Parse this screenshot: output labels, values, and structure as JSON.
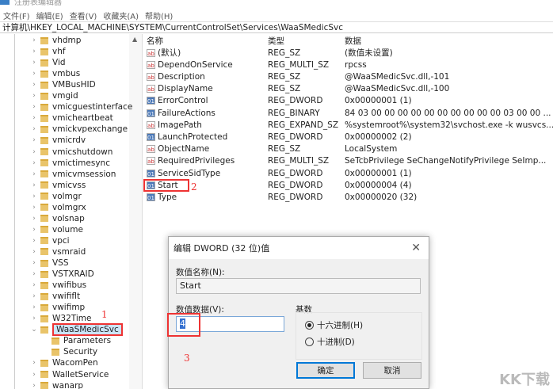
{
  "window": {
    "title": "注册表编辑器"
  },
  "menu": [
    "文件(F)",
    "编辑(E)",
    "查看(V)",
    "收藏夹(A)",
    "帮助(H)"
  ],
  "address": "计算机\\HKEY_LOCAL_MACHINE\\SYSTEM\\CurrentControlSet\\Services\\WaaSMedicSvc",
  "tree": [
    "vhdmp",
    "vhf",
    "Vid",
    "vmbus",
    "VMBusHID",
    "vmgid",
    "vmicguestinterface",
    "vmicheartbeat",
    "vmickvpexchange",
    "vmicrdv",
    "vmicshutdown",
    "vmictimesync",
    "vmicvmsession",
    "vmicvss",
    "volmgr",
    "volmgrx",
    "volsnap",
    "volume",
    "vpci",
    "vsmraid",
    "VSS",
    "VSTXRAID",
    "vwifibus",
    "vwififlt",
    "vwifimp",
    "W32Time",
    "WaaSMedicSvc",
    "Parameters",
    "Security",
    "WacomPen",
    "WalletService",
    "wanarp"
  ],
  "selected_tree": "WaaSMedicSvc",
  "columns": {
    "name": "名称",
    "type": "类型",
    "data": "数据"
  },
  "values": [
    {
      "icon": "ab",
      "name": "(默认)",
      "type": "REG_SZ",
      "data": "(数值未设置)"
    },
    {
      "icon": "ab",
      "name": "DependOnService",
      "type": "REG_MULTI_SZ",
      "data": "rpcss"
    },
    {
      "icon": "ab",
      "name": "Description",
      "type": "REG_SZ",
      "data": "@WaaSMedicSvc.dll,-101"
    },
    {
      "icon": "ab",
      "name": "DisplayName",
      "type": "REG_SZ",
      "data": "@WaaSMedicSvc.dll,-100"
    },
    {
      "icon": "bin",
      "name": "ErrorControl",
      "type": "REG_DWORD",
      "data": "0x00000001 (1)"
    },
    {
      "icon": "bin",
      "name": "FailureActions",
      "type": "REG_BINARY",
      "data": "84 03 00 00 00 00 00 00 00 00 00 00 03 00 00 ..."
    },
    {
      "icon": "ab",
      "name": "ImagePath",
      "type": "REG_EXPAND_SZ",
      "data": "%systemroot%\\system32\\svchost.exe -k wusvcs..."
    },
    {
      "icon": "bin",
      "name": "LaunchProtected",
      "type": "REG_DWORD",
      "data": "0x00000002 (2)"
    },
    {
      "icon": "ab",
      "name": "ObjectName",
      "type": "REG_SZ",
      "data": "LocalSystem"
    },
    {
      "icon": "ab",
      "name": "RequiredPrivileges",
      "type": "REG_MULTI_SZ",
      "data": "SeTcbPrivilege SeChangeNotifyPrivilege SeImp..."
    },
    {
      "icon": "bin",
      "name": "ServiceSidType",
      "type": "REG_DWORD",
      "data": "0x00000001 (1)"
    },
    {
      "icon": "bin",
      "name": "Start",
      "type": "REG_DWORD",
      "data": "0x00000004 (4)"
    },
    {
      "icon": "bin",
      "name": "Type",
      "type": "REG_DWORD",
      "data": "0x00000020 (32)"
    }
  ],
  "annotations": {
    "one": "1",
    "two": "2",
    "three": "3"
  },
  "dialog": {
    "title": "编辑 DWORD (32 位)值",
    "name_label": "数值名称(N):",
    "name_value": "Start",
    "data_label": "数值数据(V):",
    "data_value": "4",
    "base_label": "基数",
    "hex": "十六进制(H)",
    "dec": "十进制(D)",
    "ok": "确定",
    "cancel": "取消"
  },
  "watermark": "KK下载"
}
